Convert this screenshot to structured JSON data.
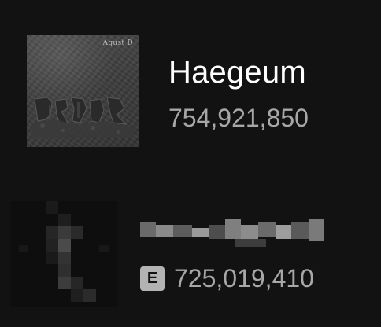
{
  "tracks": [
    {
      "title": "Haegeum",
      "plays": "754,921,850",
      "cover_text": "Agust D",
      "explicit": false
    },
    {
      "title": "",
      "plays": "725,019,410",
      "explicit": true,
      "explicit_label": "E"
    }
  ],
  "colors": {
    "background": "#121212",
    "title": "#ffffff",
    "secondary": "#a7a7a7",
    "explicit_badge": "#b3b3b3"
  },
  "icons": {
    "explicit": "explicit-icon"
  }
}
